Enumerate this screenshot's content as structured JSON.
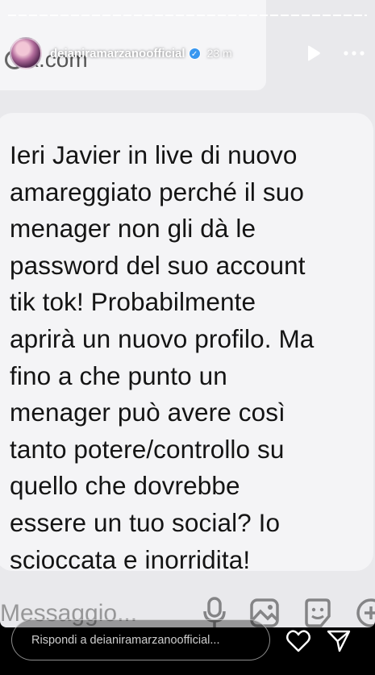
{
  "header": {
    "username": "deianiramarzanoofficial",
    "verified_mark": "✓",
    "time_ago": "23 m"
  },
  "shared_post": {
    "source": "x.com",
    "text": "Ieri Javier in live di nuovo amareggiato perché il suo menager non gli dà le password del suo account tik tok! Probabilmente aprirà un nuovo profilo. Ma fino a che punto un menager può avere così tanto potere/controllo su quello che dovrebbe essere un tuo social? Io scioccata e inorridita!",
    "lines": [
      "Ieri Javier in live di nuovo",
      "amareggiato perché il suo",
      "menager non gli dà le",
      "password del suo account",
      "tik tok! Probabilmente",
      "aprirà un nuovo profilo. Ma",
      "fino a che punto un",
      "menager può avere così",
      "tanto potere/controllo su",
      "quello che dovrebbe",
      "essere un tuo social? Io",
      "scioccata e inorridita!"
    ],
    "composer_placeholder": "Messaggio..."
  },
  "reply": {
    "placeholder": "Rispondi a deianiramarzanoofficial..."
  },
  "icons": {
    "play": "play-icon",
    "more": "more-icon",
    "heart": "heart-icon",
    "send": "send-icon"
  },
  "colors": {
    "verified": "#3897f0",
    "card_bg": "#f4f4f6",
    "story_bg": "#e9e9ec"
  }
}
